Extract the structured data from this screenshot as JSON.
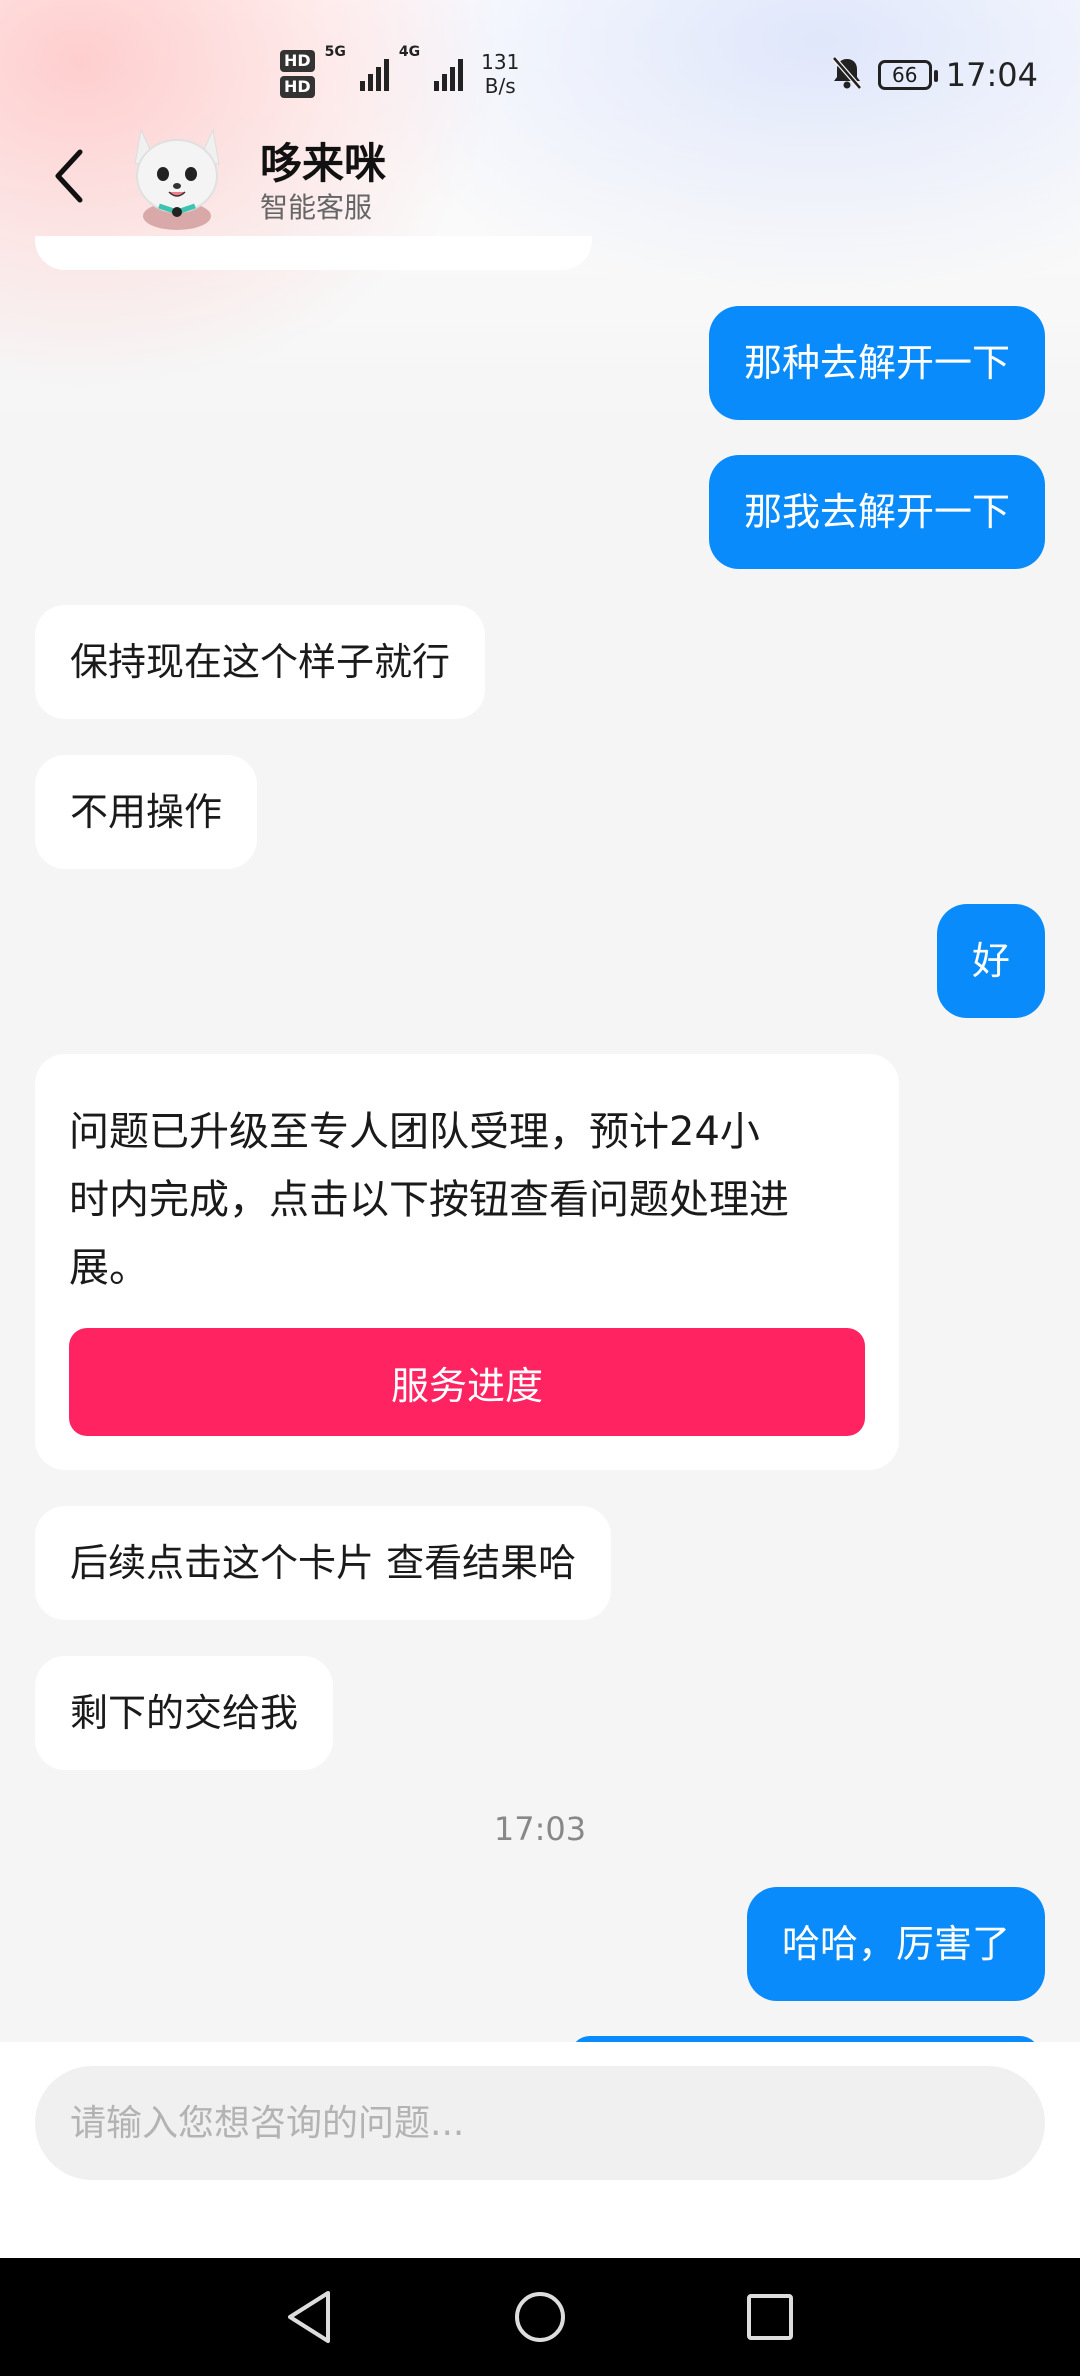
{
  "status_bar": {
    "hd1": "HD",
    "hd2": "HD",
    "sim1_gen": "5G",
    "sim2_gen": "4G",
    "net_speed_value": "131",
    "net_speed_unit": "B/s",
    "battery": "66",
    "time": "17:04",
    "icons": [
      "mute-icon",
      "battery-icon"
    ]
  },
  "header": {
    "back_icon": "chevron-left-icon",
    "avatar_icon": "cat-mascot-avatar",
    "title": "哆来咪",
    "subtitle": "智能客服"
  },
  "messages": [
    {
      "side": "out",
      "text": "那种去解开一下"
    },
    {
      "side": "out",
      "text": "那我去解开一下"
    },
    {
      "side": "in",
      "text": "保持现在这个样子就行"
    },
    {
      "side": "in",
      "text": "不用操作"
    },
    {
      "side": "out",
      "text": "好"
    },
    {
      "side": "in",
      "type": "card",
      "lines": [
        "问题已升级至专人团队受理，预计24小",
        "时内完成，点击以下按钮查看问题处理进",
        "展。"
      ],
      "button": "服务进度"
    },
    {
      "side": "in",
      "text": "后续点击这个卡片 查看结果哈"
    },
    {
      "side": "in",
      "text": "剩下的交给我"
    },
    {
      "type": "timestamp",
      "text": "17:03"
    },
    {
      "side": "out",
      "text": "哈哈，厉害了"
    }
  ],
  "input": {
    "placeholder": "请输入您想咨询的问题..."
  },
  "colors": {
    "outgoing_bubble": "#0a8bfb",
    "card_button": "#ff2362",
    "background": "#f5f5f5"
  },
  "nav_bar": {
    "icons": [
      "nav-back-icon",
      "nav-home-icon",
      "nav-recents-icon"
    ]
  }
}
